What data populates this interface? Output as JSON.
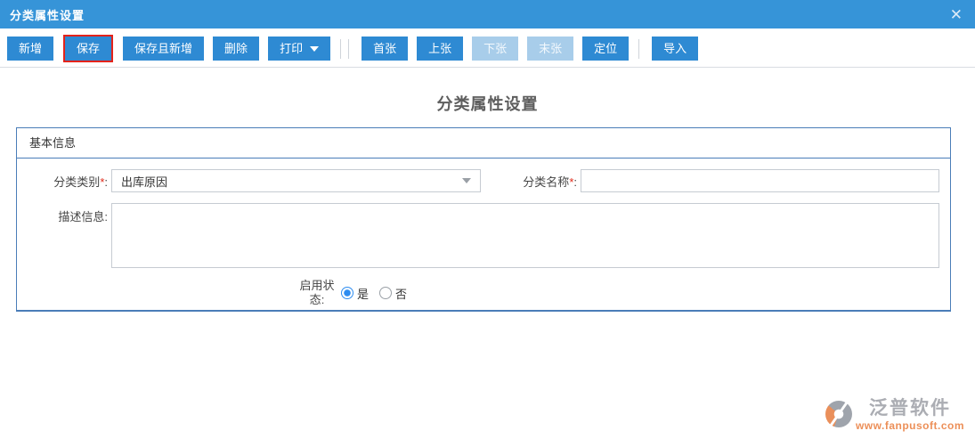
{
  "titlebar": {
    "title": "分类属性设置",
    "close_icon": "✕"
  },
  "toolbar": {
    "buttons": [
      {
        "label": "新增",
        "state": "normal"
      },
      {
        "label": "保存",
        "state": "highlighted"
      },
      {
        "label": "保存且新增",
        "state": "normal"
      },
      {
        "label": "删除",
        "state": "normal"
      },
      {
        "label": "打印",
        "state": "dropdown"
      },
      {
        "label": "首张",
        "state": "normal"
      },
      {
        "label": "上张",
        "state": "normal"
      },
      {
        "label": "下张",
        "state": "disabled"
      },
      {
        "label": "末张",
        "state": "disabled"
      },
      {
        "label": "定位",
        "state": "normal"
      },
      {
        "label": "导入",
        "state": "normal"
      }
    ]
  },
  "page": {
    "title": "分类属性设置"
  },
  "form": {
    "section_title": "基本信息",
    "fields": {
      "category_type": {
        "label": "分类类别",
        "required": "*",
        "colon": ":",
        "value": "出库原因"
      },
      "category_name": {
        "label": "分类名称",
        "required": "*",
        "colon": ":",
        "value": ""
      },
      "description": {
        "label": "描述信息",
        "colon": ":",
        "value": ""
      },
      "enable_status": {
        "label": "启用状态",
        "colon": ":",
        "options": [
          {
            "label": "是",
            "selected": true
          },
          {
            "label": "否",
            "selected": false
          }
        ]
      }
    }
  },
  "watermark": {
    "brand": "泛普软件",
    "url": "www.fanpusoft.com"
  },
  "colors": {
    "titlebar_blue": "#3694d8",
    "button_blue": "#2e8ad3",
    "button_disabled_blue": "#a8cdea",
    "highlight_red": "#e4231b",
    "panel_border_blue": "#4a7db8",
    "radio_selected_blue": "#2d8cf0",
    "watermark_orange": "#ec8a50",
    "watermark_gray": "#a7a9af"
  }
}
